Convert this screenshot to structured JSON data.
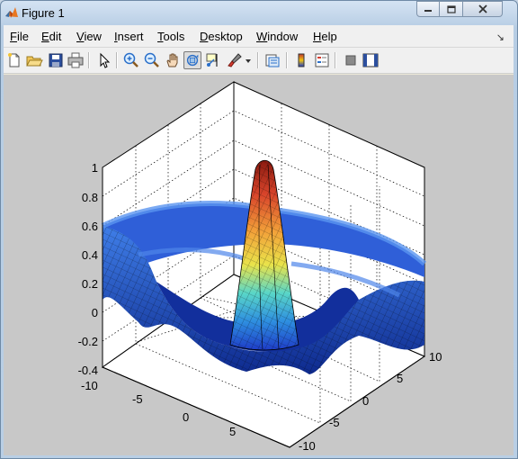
{
  "window": {
    "title": "Figure 1",
    "controls": [
      "minimize-icon",
      "maximize-icon",
      "close-icon"
    ]
  },
  "menubar": {
    "items": [
      {
        "label": "File",
        "key": "F"
      },
      {
        "label": "Edit",
        "key": "E"
      },
      {
        "label": "View",
        "key": "V"
      },
      {
        "label": "Insert",
        "key": "I"
      },
      {
        "label": "Tools",
        "key": "T"
      },
      {
        "label": "Desktop",
        "key": "D"
      },
      {
        "label": "Window",
        "key": "W"
      },
      {
        "label": "Help",
        "key": "H"
      }
    ],
    "dock_icon": "dock-arrow-icon"
  },
  "toolbar": {
    "buttons": [
      "new-figure-icon",
      "open-file-icon",
      "save-icon",
      "print-icon",
      "edit-plot-icon",
      "zoom-in-icon",
      "zoom-out-icon",
      "pan-icon",
      "rotate-3d-icon",
      "data-cursor-icon",
      "brush-icon",
      "link-plot-icon",
      "colorbar-icon",
      "legend-icon",
      "hide-plot-tools-icon",
      "show-plot-tools-icon"
    ],
    "active": "rotate-3d-icon"
  },
  "axes": {
    "z_ticks": [
      "1",
      "0.8",
      "0.6",
      "0.4",
      "0.2",
      "0",
      "-0.2",
      "-0.4"
    ],
    "x_ticks": [
      "-10",
      "-5",
      "0",
      "5",
      "10"
    ],
    "y_ticks": [
      "10",
      "5",
      "0",
      "-5",
      "-10"
    ],
    "zlim": [
      -0.4,
      1
    ],
    "xlim": [
      -10,
      10
    ],
    "ylim": [
      -10,
      10
    ],
    "grid": true,
    "surface": "sinc (ripple) surface, jet colormap",
    "colors": {
      "background": "#c8c8c8",
      "axes_face": "#ffffff",
      "peak": "#c0392b",
      "base": "#1e3cc8"
    }
  }
}
